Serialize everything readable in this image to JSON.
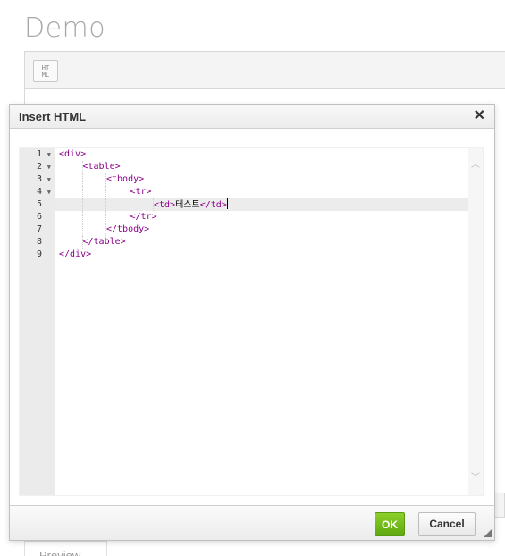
{
  "page": {
    "title": "Demo",
    "html_button_label": "HT\nML",
    "bg_tab_label": "Preview"
  },
  "dialog": {
    "title": "Insert HTML",
    "close_icon": "close-icon",
    "ok_label": "OK",
    "cancel_label": "Cancel",
    "colors": {
      "ok_green": "#6ab61a",
      "tag_purple": "#8b008b",
      "gutter_bg": "#ebebeb"
    }
  },
  "code_editor": {
    "active_line": 5,
    "lines": [
      {
        "num": "1",
        "fold": true,
        "indent": 0,
        "tokens": [
          {
            "t": "tag",
            "v": "<div>"
          }
        ]
      },
      {
        "num": "2",
        "fold": true,
        "indent": 1,
        "tokens": [
          {
            "t": "tag",
            "v": "<table>"
          }
        ]
      },
      {
        "num": "3",
        "fold": true,
        "indent": 2,
        "tokens": [
          {
            "t": "tag",
            "v": "<tbody>"
          }
        ]
      },
      {
        "num": "4",
        "fold": true,
        "indent": 3,
        "tokens": [
          {
            "t": "tag",
            "v": "<tr>"
          }
        ]
      },
      {
        "num": "5",
        "fold": false,
        "indent": 4,
        "tokens": [
          {
            "t": "tag",
            "v": "<td>"
          },
          {
            "t": "txt",
            "v": "테스트"
          },
          {
            "t": "tag",
            "v": "</td>"
          }
        ],
        "caret": true
      },
      {
        "num": "6",
        "fold": false,
        "indent": 3,
        "tokens": [
          {
            "t": "tag",
            "v": "</tr>"
          }
        ]
      },
      {
        "num": "7",
        "fold": false,
        "indent": 2,
        "tokens": [
          {
            "t": "tag",
            "v": "</tbody>"
          }
        ]
      },
      {
        "num": "8",
        "fold": false,
        "indent": 1,
        "tokens": [
          {
            "t": "tag",
            "v": "</table>"
          }
        ]
      },
      {
        "num": "9",
        "fold": false,
        "indent": 0,
        "tokens": [
          {
            "t": "tag",
            "v": "</div>"
          }
        ]
      }
    ]
  }
}
